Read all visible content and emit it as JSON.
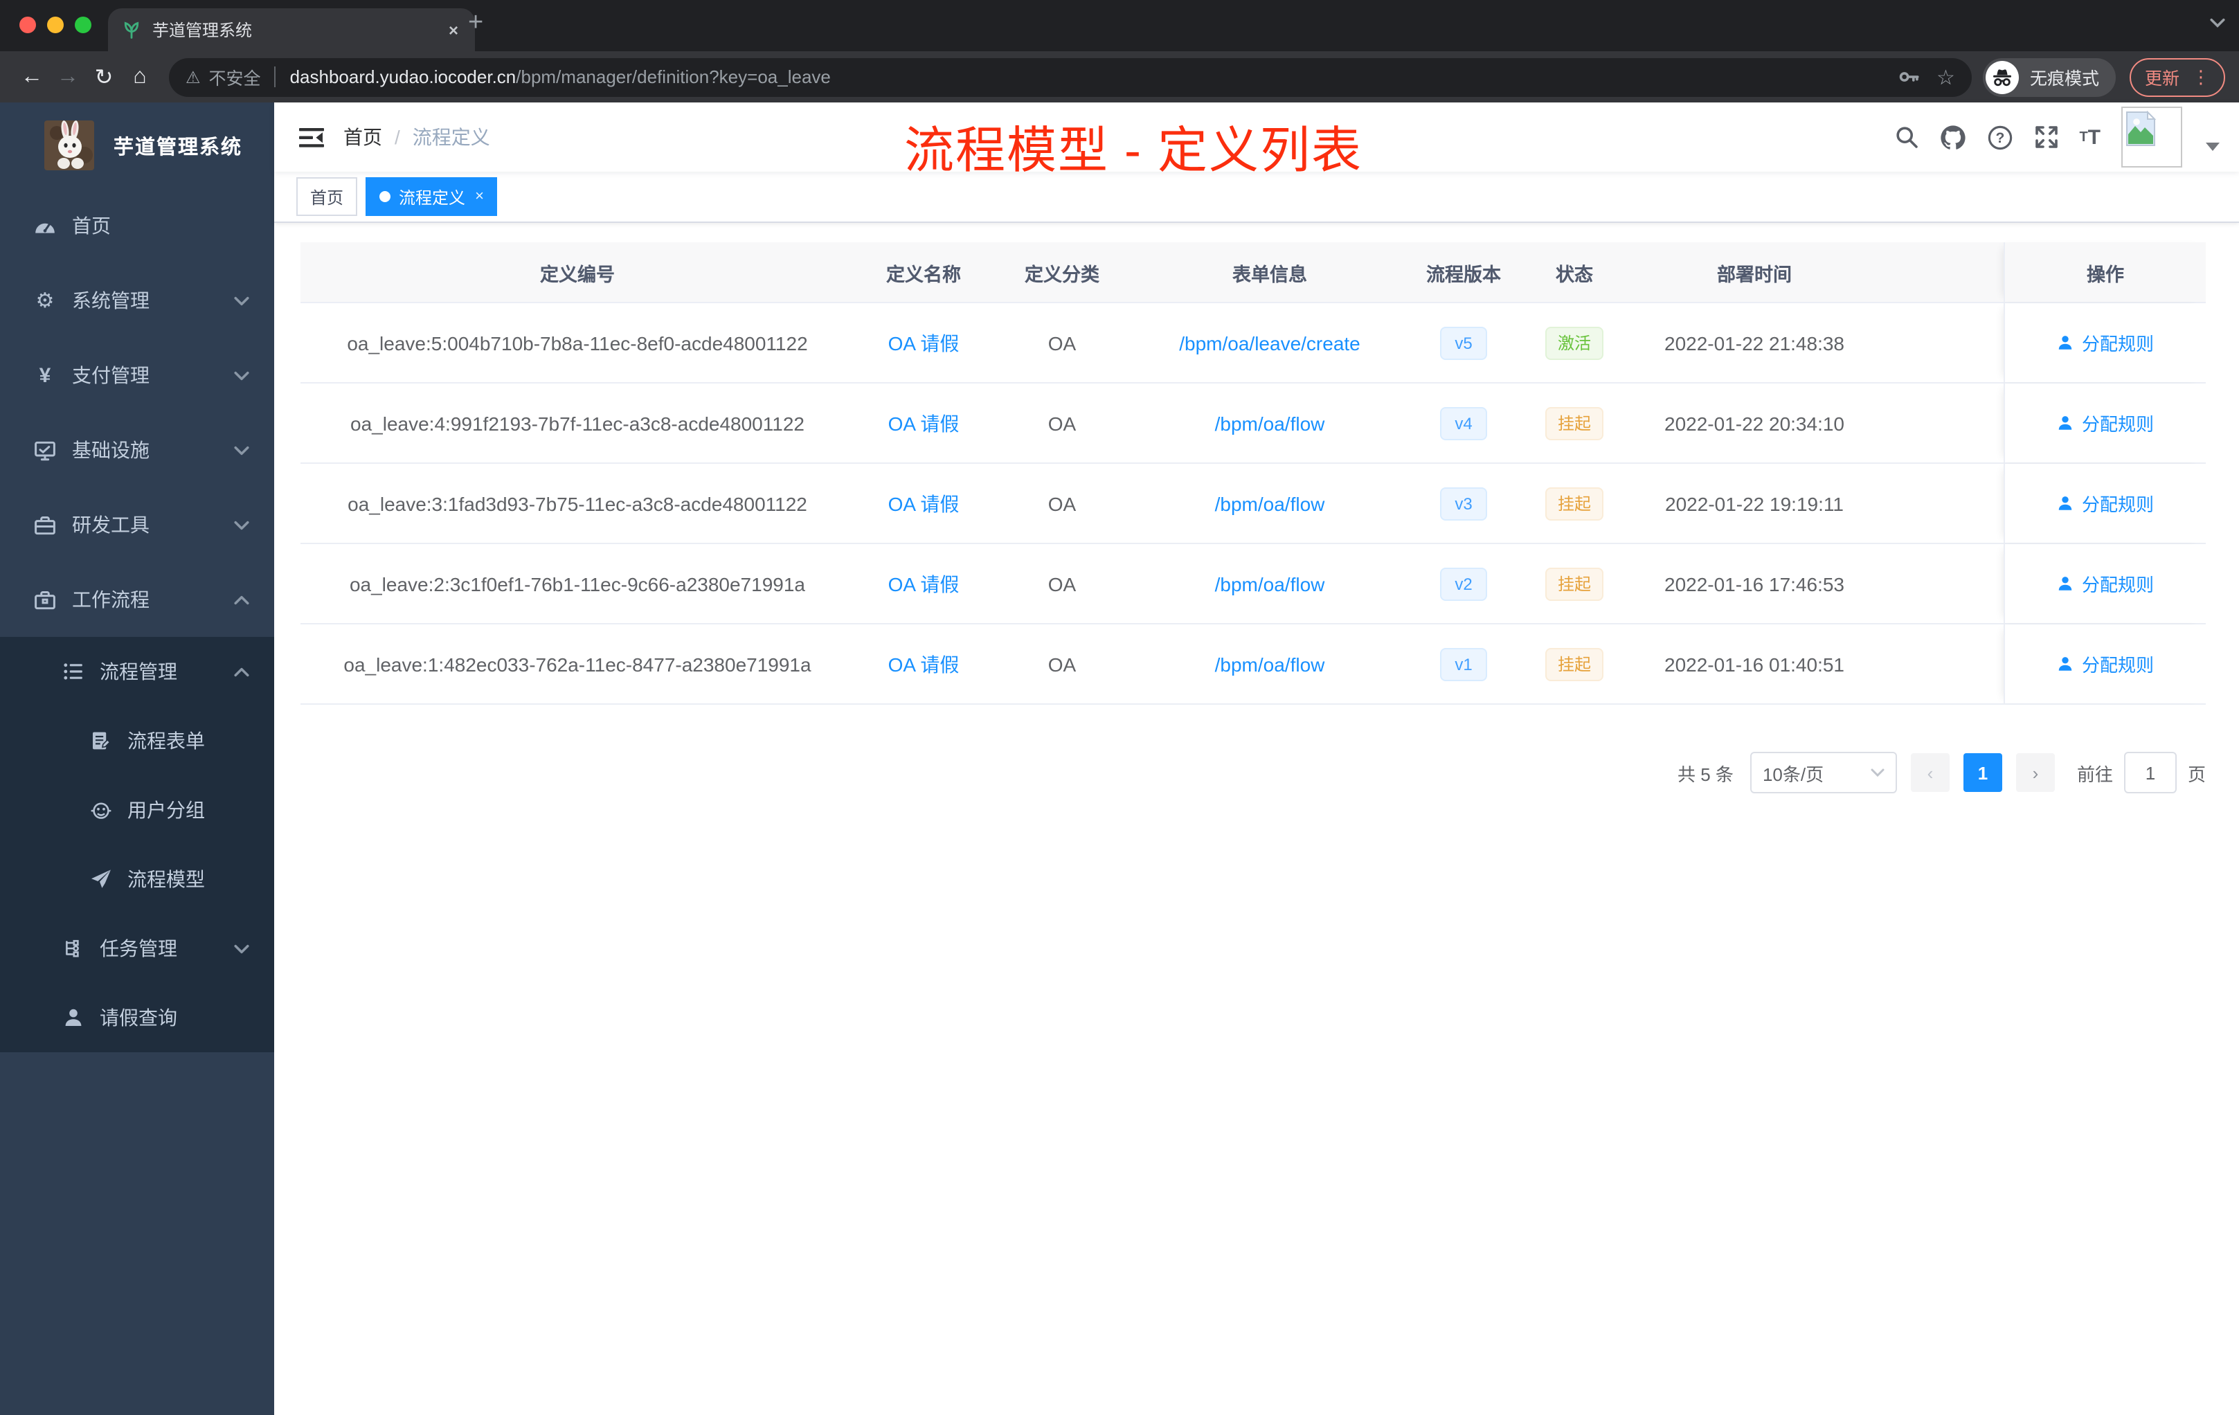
{
  "colors": {
    "primary": "#1890ff",
    "tag_version_text": "#409eff",
    "status_success": "#67c23a",
    "status_warning": "#e6a23c",
    "annotation_red": "#fb2e0e",
    "sidebar_bg": "#2f3e52",
    "sidebar_sub_bg": "#1f2d3d",
    "traffic_red": "#ff5f57",
    "traffic_yellow": "#febc2e",
    "traffic_green": "#28c840"
  },
  "browser": {
    "tab_title": "芋道管理系统",
    "tab_close": "×",
    "new_tab": "+",
    "security_label": "不安全",
    "url_host": "dashboard.yudao.iocoder.cn",
    "url_path": "/bpm/manager/definition?key=oa_leave",
    "back": "←",
    "forward": "→",
    "reload": "↻",
    "home": "⌂",
    "star": "☆",
    "warning": "⚠",
    "incognito_label": "无痕模式",
    "update_label": "更新",
    "update_dots": "⋮"
  },
  "sidebar": {
    "app_title": "芋道管理系统",
    "menu": [
      {
        "label": "首页",
        "icon": "dashboard-icon",
        "arrow": ""
      },
      {
        "label": "系统管理",
        "icon": "gear-icon",
        "arrow": "down"
      },
      {
        "label": "支付管理",
        "icon": "yen-icon",
        "arrow": "down"
      },
      {
        "label": "基础设施",
        "icon": "monitor-icon",
        "arrow": "down"
      },
      {
        "label": "研发工具",
        "icon": "toolbox-icon",
        "arrow": "down"
      },
      {
        "label": "工作流程",
        "icon": "briefcase-icon",
        "arrow": "up"
      },
      {
        "label": "流程管理",
        "icon": "list-icon",
        "arrow": "up"
      },
      {
        "label": "流程表单",
        "icon": "form-icon",
        "arrow": ""
      },
      {
        "label": "用户分组",
        "icon": "robot-icon",
        "arrow": ""
      },
      {
        "label": "流程模型",
        "icon": "paper-plane-icon",
        "arrow": ""
      },
      {
        "label": "任务管理",
        "icon": "tree-icon",
        "arrow": "down"
      },
      {
        "label": "请假查询",
        "icon": "user-icon",
        "arrow": ""
      }
    ],
    "yen_glyph": "¥",
    "gear_glyph": "⚙"
  },
  "navbar": {
    "breadcrumb_home": "首页",
    "breadcrumb_separator": "/",
    "breadcrumb_current": "流程定义"
  },
  "annotation": {
    "text": "流程模型 - 定义列表"
  },
  "tags": [
    {
      "label": "首页",
      "active": false
    },
    {
      "label": "流程定义",
      "active": true,
      "close": "×"
    }
  ],
  "table": {
    "headers": [
      "定义编号",
      "定义名称",
      "定义分类",
      "表单信息",
      "流程版本",
      "状态",
      "部署时间",
      "操作"
    ],
    "rows": [
      {
        "id": "oa_leave:5:004b710b-7b8a-11ec-8ef0-acde48001122",
        "name": "OA 请假",
        "category": "OA",
        "form": "/bpm/oa/leave/create",
        "version": "v5",
        "status": "激活",
        "status_type": "success",
        "deploy_time": "2022-01-22 21:48:38",
        "action": "分配规则"
      },
      {
        "id": "oa_leave:4:991f2193-7b7f-11ec-a3c8-acde48001122",
        "name": "OA 请假",
        "category": "OA",
        "form": "/bpm/oa/flow",
        "version": "v4",
        "status": "挂起",
        "status_type": "warning",
        "deploy_time": "2022-01-22 20:34:10",
        "action": "分配规则"
      },
      {
        "id": "oa_leave:3:1fad3d93-7b75-11ec-a3c8-acde48001122",
        "name": "OA 请假",
        "category": "OA",
        "form": "/bpm/oa/flow",
        "version": "v3",
        "status": "挂起",
        "status_type": "warning",
        "deploy_time": "2022-01-22 19:19:11",
        "action": "分配规则"
      },
      {
        "id": "oa_leave:2:3c1f0ef1-76b1-11ec-9c66-a2380e71991a",
        "name": "OA 请假",
        "category": "OA",
        "form": "/bpm/oa/flow",
        "version": "v2",
        "status": "挂起",
        "status_type": "warning",
        "deploy_time": "2022-01-16 17:46:53",
        "action": "分配规则"
      },
      {
        "id": "oa_leave:1:482ec033-762a-11ec-8477-a2380e71991a",
        "name": "OA 请假",
        "category": "OA",
        "form": "/bpm/oa/flow",
        "version": "v1",
        "status": "挂起",
        "status_type": "warning",
        "deploy_time": "2022-01-16 01:40:51",
        "action": "分配规则"
      }
    ]
  },
  "pagination": {
    "total_text": "共 5 条",
    "page_size": "10条/页",
    "prev": "‹",
    "current_page": "1",
    "next": "›",
    "goto_label": "前往",
    "goto_value": "1",
    "page_unit": "页"
  }
}
